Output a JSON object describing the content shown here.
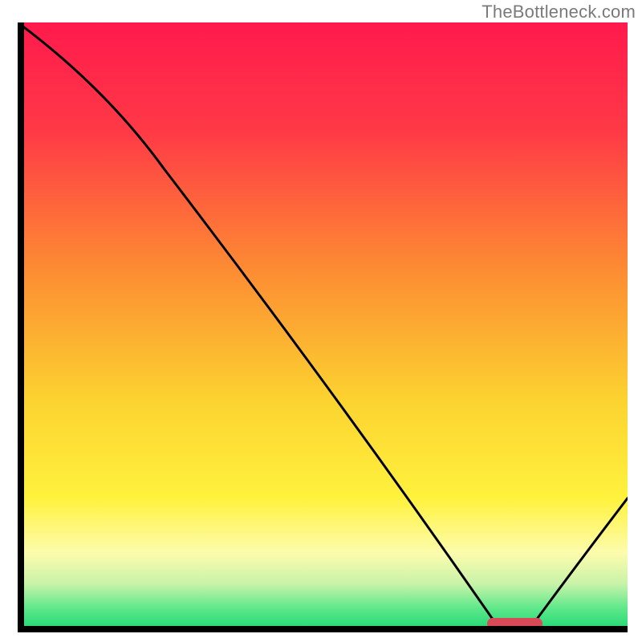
{
  "watermark": "TheBottleneck.com",
  "chart_data": {
    "type": "line",
    "title": "",
    "xlabel": "",
    "ylabel": "",
    "xlim": [
      0,
      100
    ],
    "ylim": [
      0,
      100
    ],
    "grid": false,
    "annotations": [],
    "curve": [
      {
        "x": 0,
        "y": 100
      },
      {
        "x": 24,
        "y": 76
      },
      {
        "x": 78,
        "y": 2
      },
      {
        "x": 85,
        "y": 2
      },
      {
        "x": 100,
        "y": 22
      }
    ],
    "highlight_segment": {
      "x_start": 77,
      "x_end": 86,
      "y": 1.5
    },
    "background_gradient_stops": [
      {
        "offset": 0,
        "color": "#ff1a4d"
      },
      {
        "offset": 18,
        "color": "#ff3a46"
      },
      {
        "offset": 40,
        "color": "#fd8a33"
      },
      {
        "offset": 62,
        "color": "#fcd330"
      },
      {
        "offset": 78,
        "color": "#fff23d"
      },
      {
        "offset": 87,
        "color": "#fdfcad"
      },
      {
        "offset": 92,
        "color": "#c9f3a9"
      },
      {
        "offset": 96,
        "color": "#5fe88b"
      },
      {
        "offset": 100,
        "color": "#18d671"
      }
    ]
  }
}
